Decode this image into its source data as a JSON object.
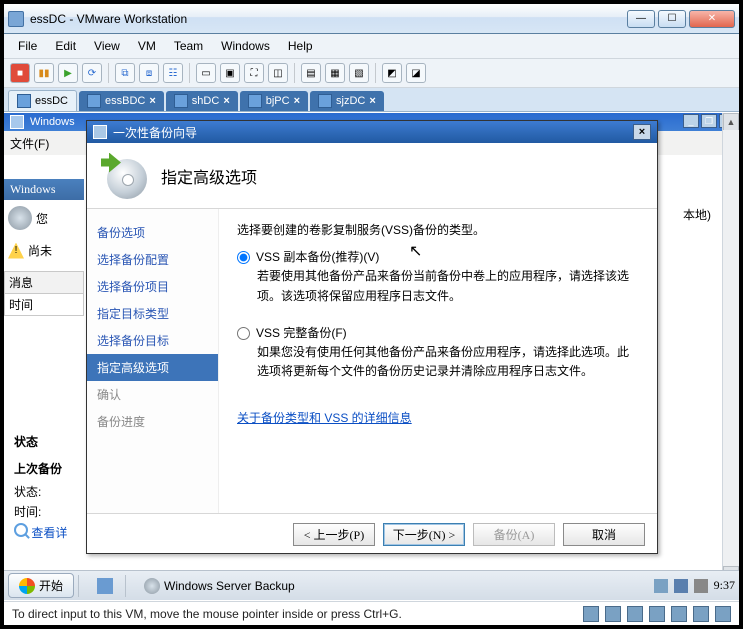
{
  "vm": {
    "title": "essDC - VMware Workstation",
    "menu": [
      "File",
      "Edit",
      "View",
      "VM",
      "Team",
      "Windows",
      "Help"
    ],
    "tabs": [
      {
        "label": "essDC",
        "active": true
      },
      {
        "label": "essBDC",
        "active": false
      },
      {
        "label": "shDC",
        "active": false
      },
      {
        "label": "bjPC",
        "active": false
      },
      {
        "label": "sjzDC",
        "active": false
      }
    ],
    "status_hint": "To direct input to this VM, move the mouse pointer inside or press Ctrl+G."
  },
  "inner": {
    "titlebar": "Windows",
    "menu_file": "文件(F)",
    "sidebar_header": "Windows",
    "you_label": "您",
    "warn_label": "尚未",
    "messages_header": "消息",
    "time_col": "时间",
    "right_local": "本地)",
    "status_header": "状态",
    "last_backup": "上次备份",
    "state": "状态:",
    "time": "时间:",
    "view_details": "查看详"
  },
  "taskbar": {
    "start": "开始",
    "app": "Windows Server Backup",
    "clock": "9:37"
  },
  "wizard": {
    "title": "一次性备份向导",
    "heading": "指定高级选项",
    "nav": [
      {
        "label": "备份选项",
        "state": "done"
      },
      {
        "label": "选择备份配置",
        "state": "done"
      },
      {
        "label": "选择备份项目",
        "state": "done"
      },
      {
        "label": "指定目标类型",
        "state": "done"
      },
      {
        "label": "选择备份目标",
        "state": "done"
      },
      {
        "label": "指定高级选项",
        "state": "active"
      },
      {
        "label": "确认",
        "state": "pending"
      },
      {
        "label": "备份进度",
        "state": "pending"
      }
    ],
    "intro": "选择要创建的卷影复制服务(VSS)备份的类型。",
    "opt1_label": "VSS 副本备份(推荐)(V)",
    "opt1_desc": "若要使用其他备份产品来备份当前备份中卷上的应用程序，请选择该选项。该选项将保留应用程序日志文件。",
    "opt2_label": "VSS 完整备份(F)",
    "opt2_desc": "如果您没有使用任何其他备份产品来备份应用程序，请选择此选项。此选项将更新每个文件的备份历史记录并清除应用程序日志文件。",
    "link": "关于备份类型和 VSS 的详细信息",
    "btn_prev": "< 上一步(P)",
    "btn_next": "下一步(N) >",
    "btn_backup": "备份(A)",
    "btn_cancel": "取消"
  }
}
